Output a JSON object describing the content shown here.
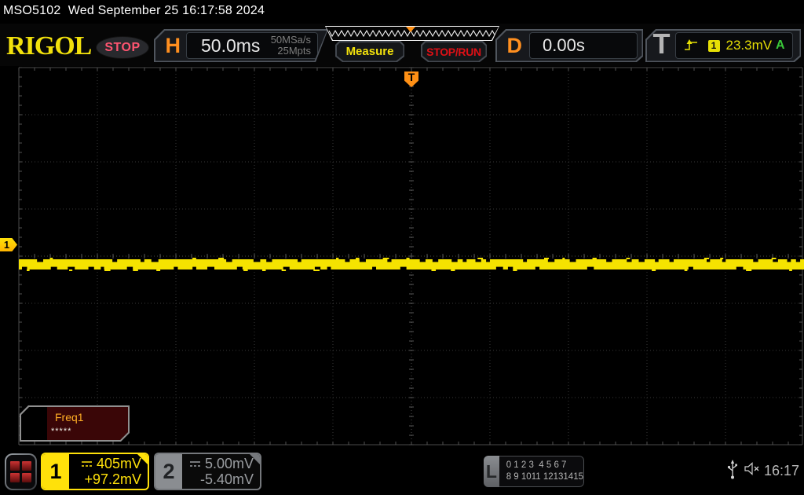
{
  "title_bar": {
    "text": "MSO5102  Wed September 25 16:17:58 2024"
  },
  "toolbar": {
    "brand": "RIGOL",
    "acquisition_status": "STOP",
    "horizontal": {
      "label": "H",
      "timebase": "50.0ms",
      "sample_rate": "50MSa/s",
      "memory_depth": "25Mpts"
    },
    "measure_label": "Measure",
    "stop_run_label": "STOP/RUN",
    "delay": {
      "label": "D",
      "value": "0.00s"
    },
    "trigger": {
      "label": "T",
      "source_badge": "1",
      "level": "23.3mV",
      "sweep_mode": "A"
    }
  },
  "display": {
    "trigger_marker_label": "T",
    "channel1_marker_label": "1",
    "measurement": {
      "name": "Freq1",
      "value": "*****"
    }
  },
  "bottom_bar": {
    "channels": [
      {
        "badge": "1",
        "scale": "405mV",
        "offset": "+97.2mV"
      },
      {
        "badge": "2",
        "scale": "5.00mV",
        "offset": "-5.40mV"
      }
    ],
    "logic": {
      "label": "L",
      "row1": "0 1 2 3  4 5 6 7",
      "row2": "8 9 1011 12131415"
    },
    "clock": "16:17"
  },
  "colors": {
    "channel1_yellow": "#ffe10a",
    "orange_accent": "#ff8f1f",
    "stop_red": "#dd1016",
    "status_pink": "#ff5570",
    "auto_green": "#3ac93a"
  }
}
